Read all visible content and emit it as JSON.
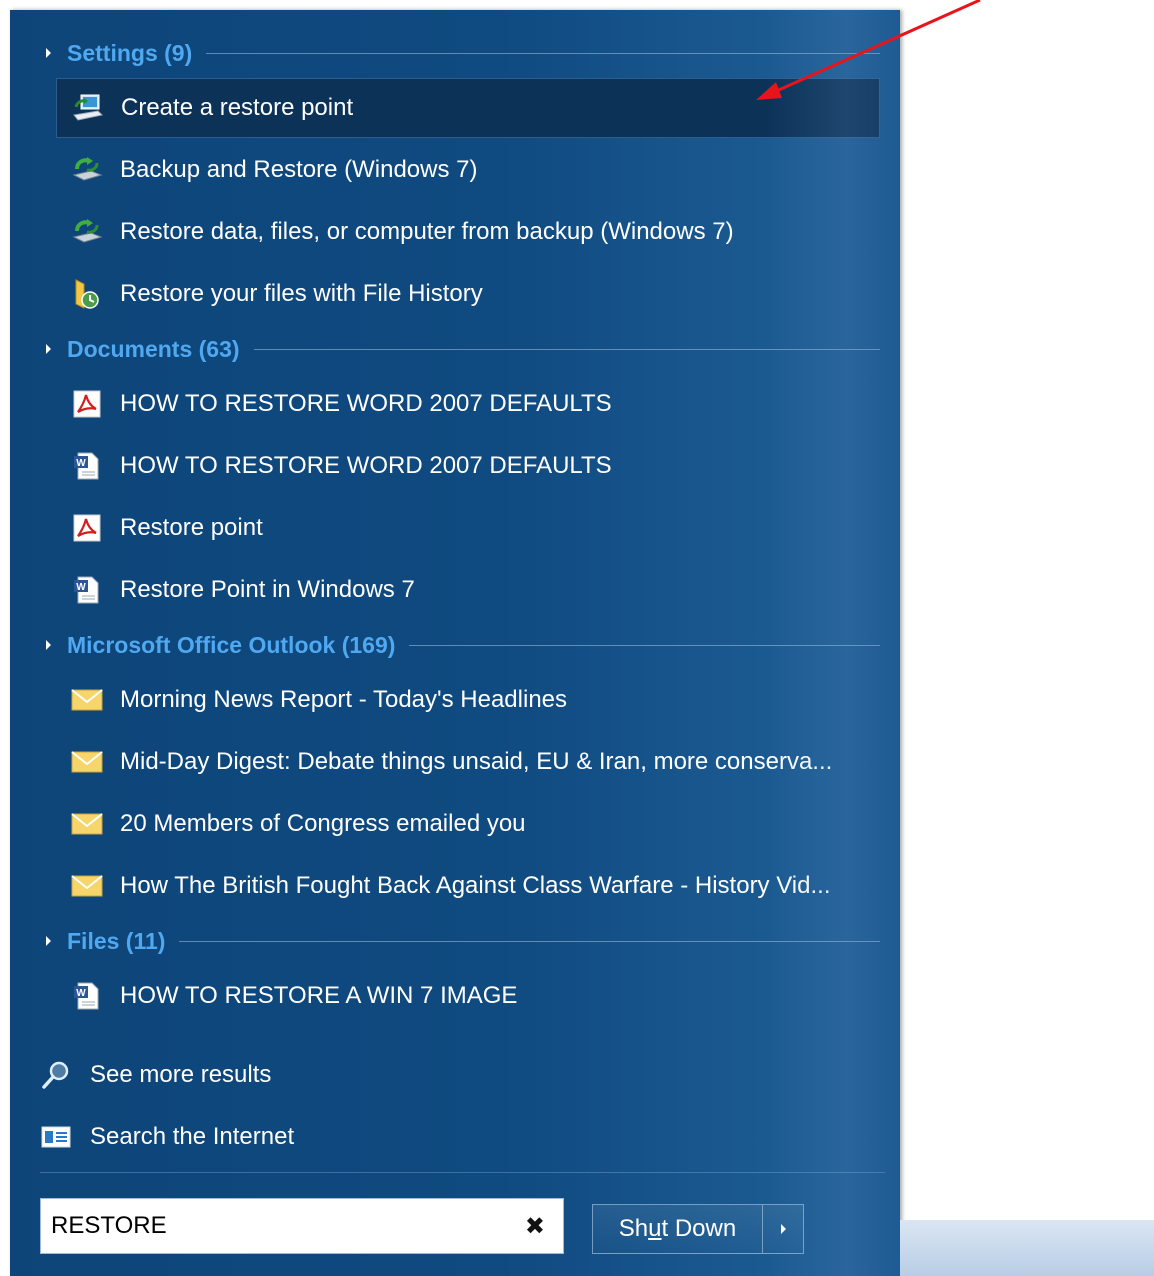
{
  "groups": {
    "settings": {
      "header": "Settings (9)",
      "items": [
        {
          "label": "Create a restore point",
          "icon": "restore-point-icon"
        },
        {
          "label": "Backup and Restore (Windows 7)",
          "icon": "backup-restore-icon"
        },
        {
          "label": "Restore data, files, or computer from backup (Windows 7)",
          "icon": "backup-restore-icon"
        },
        {
          "label": "Restore your files with File History",
          "icon": "file-history-icon"
        }
      ]
    },
    "documents": {
      "header": "Documents (63)",
      "items": [
        {
          "label": "HOW TO RESTORE WORD 2007 DEFAULTS",
          "icon": "pdf-icon"
        },
        {
          "label": "HOW TO RESTORE WORD 2007 DEFAULTS",
          "icon": "word-doc-icon"
        },
        {
          "label": "Restore point",
          "icon": "pdf-icon"
        },
        {
          "label": "Restore Point in Windows 7",
          "icon": "word-doc-icon"
        }
      ]
    },
    "outlook": {
      "header": "Microsoft Office Outlook (169)",
      "items": [
        {
          "label": "Morning News Report - Today's Headlines",
          "icon": "envelope-icon"
        },
        {
          "label": "Mid-Day Digest: Debate things unsaid, EU & Iran, more conserva...",
          "icon": "envelope-icon"
        },
        {
          "label": "20 Members of Congress emailed you",
          "icon": "envelope-icon"
        },
        {
          "label": "How The British Fought Back Against Class Warfare - History Vid...",
          "icon": "envelope-icon"
        }
      ]
    },
    "files": {
      "header": "Files (11)",
      "items": [
        {
          "label": "HOW TO RESTORE A WIN 7 IMAGE",
          "icon": "word-doc-icon"
        }
      ]
    }
  },
  "links": {
    "see_more": "See more results",
    "search_internet": "Search the Internet"
  },
  "search": {
    "value": "RESTORE"
  },
  "shutdown": {
    "label_pre": "Sh",
    "label_mnemonic": "u",
    "label_post": "t Down"
  },
  "colors": {
    "menu_bg": "#0f4a80",
    "group_header": "#4fa8f0",
    "selected_bg": "#0c3258",
    "annotation_arrow": "#e8141c"
  }
}
